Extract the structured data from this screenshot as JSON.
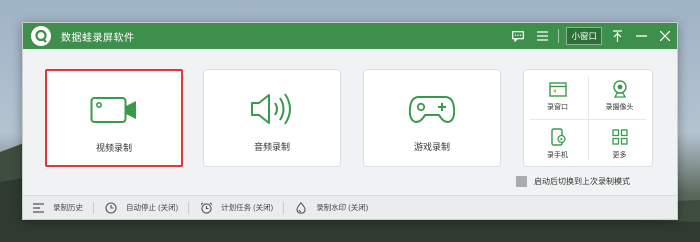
{
  "app": {
    "title": "数据蛙录屏软件"
  },
  "titlebar": {
    "mini_window_label": "小窗口"
  },
  "main_cards": [
    {
      "label": "视频录制",
      "icon": "video-camera-icon",
      "selected": true
    },
    {
      "label": "音频录制",
      "icon": "speaker-icon",
      "selected": false
    },
    {
      "label": "游戏录制",
      "icon": "gamepad-icon",
      "selected": false
    }
  ],
  "small_tools": [
    {
      "label": "录窗口",
      "icon": "window-icon"
    },
    {
      "label": "录摄像头",
      "icon": "webcam-icon"
    },
    {
      "label": "录手机",
      "icon": "phone-icon"
    },
    {
      "label": "更多",
      "icon": "grid-icon"
    }
  ],
  "auto_switch": {
    "label": "启动后切换到上次录制模式",
    "checked": false
  },
  "bottombar": {
    "history": "录制历史",
    "auto_stop": "自动停止 (关闭)",
    "schedule": "计划任务 (关闭)",
    "watermark": "录制水印 (关闭)"
  },
  "colors": {
    "brand": "#3f8f4c",
    "selection": "#e0373a",
    "icon": "#3a9a4c"
  }
}
